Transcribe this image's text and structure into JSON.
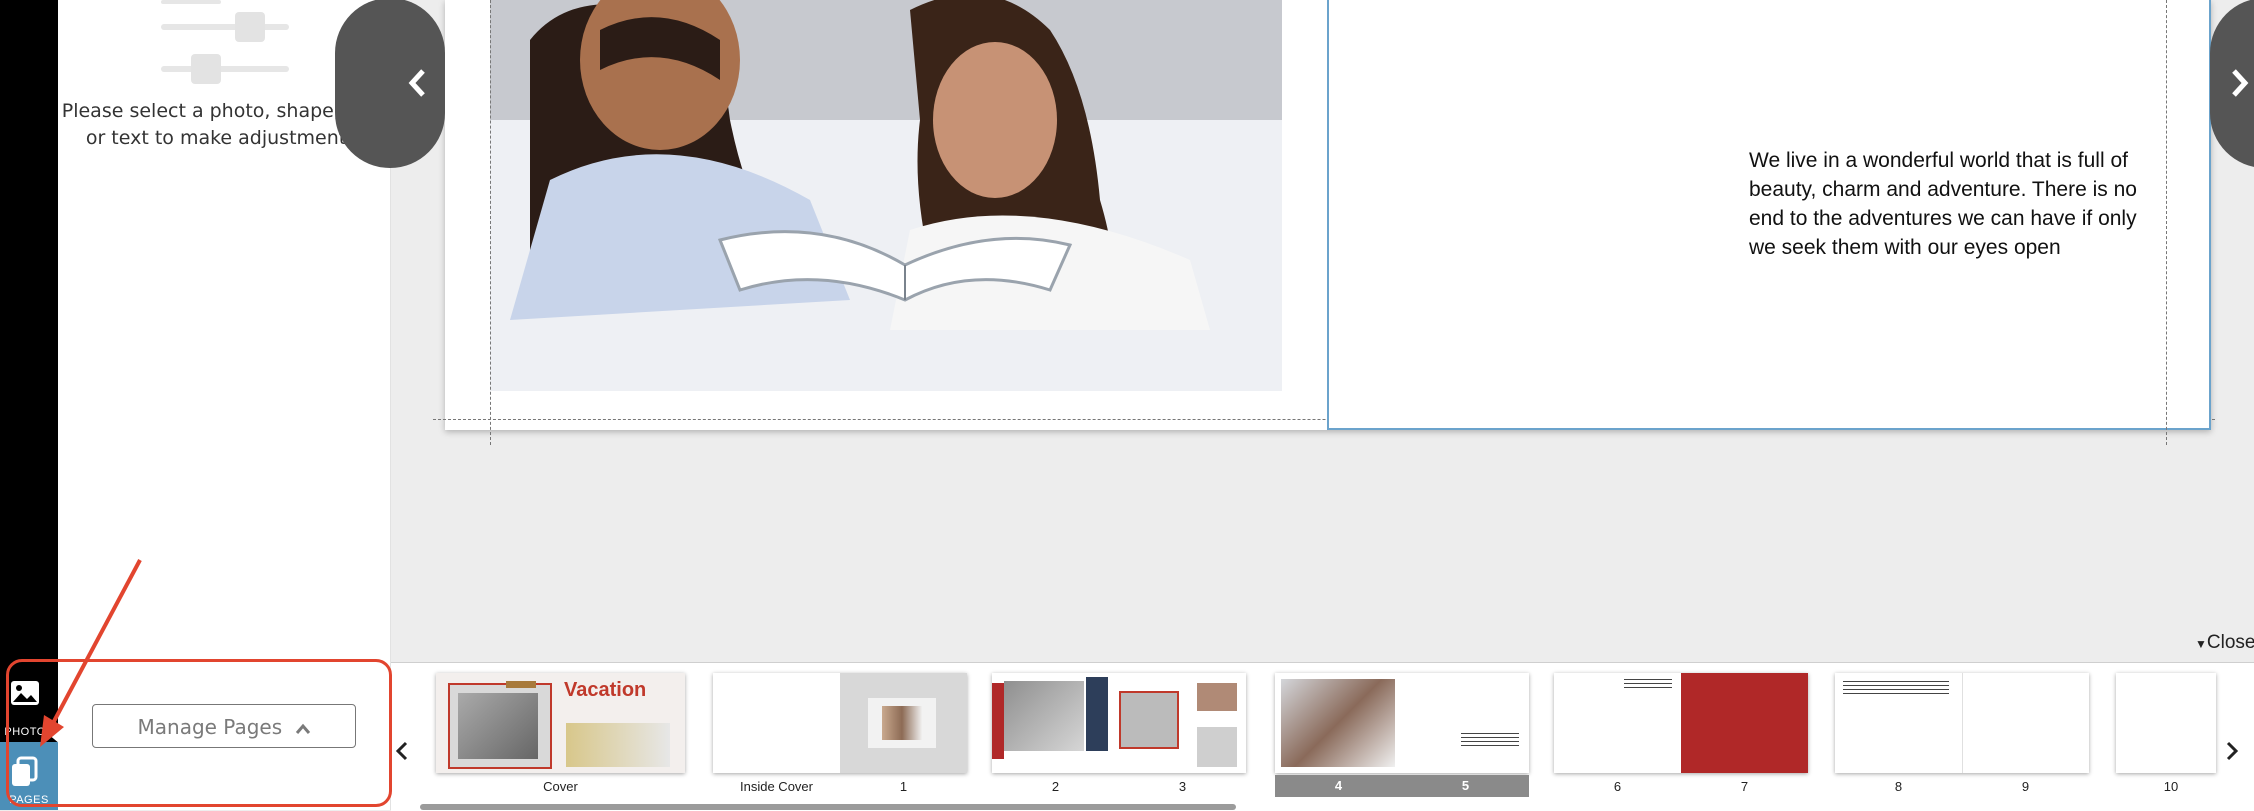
{
  "rail": {
    "photos_label": "PHOTOS",
    "pages_label": "PAGES"
  },
  "panel": {
    "hint": "Please select a photo, shape, line, or text to make adjustments.",
    "manage_pages_label": "Manage Pages"
  },
  "canvas": {
    "body_text": "We live in a wonderful world that is full of beauty, charm and adventure. There is no end to the adventures we can have if only we seek them with our eyes open",
    "close_label": "Close"
  },
  "filmstrip": {
    "cover": {
      "label": "Cover",
      "title": "Vacation"
    },
    "inside_cover_label": "Inside Cover",
    "page_labels": [
      "1",
      "2",
      "3",
      "4",
      "5",
      "6",
      "7",
      "8",
      "9",
      "10"
    ]
  },
  "colors": {
    "accent_blue": "#4c8fb8",
    "annotation_red": "#e2452f",
    "page_red": "#b02828"
  }
}
